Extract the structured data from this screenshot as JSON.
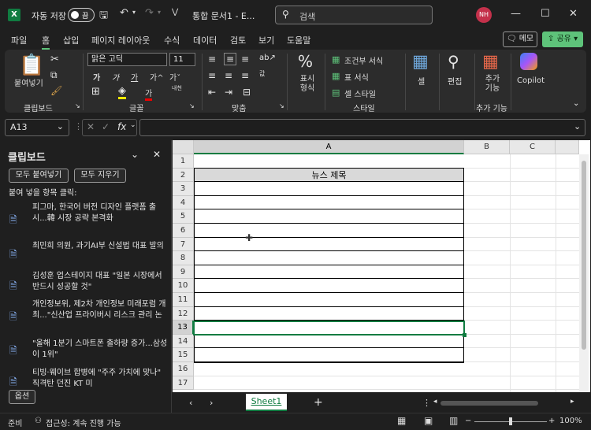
{
  "titlebar": {
    "logo": "X",
    "autosave_label": "자동 저장",
    "toggle_state": "끔",
    "doc_title": "통합 문서1 - E...",
    "search_placeholder": "검색",
    "avatar": "NH",
    "undo_icon": "undo-icon",
    "redo_icon": "redo-icon"
  },
  "menu": [
    "파일",
    "홈",
    "삽입",
    "페이지 레이아웃",
    "수식",
    "데이터",
    "검토",
    "보기",
    "도움말"
  ],
  "memo_label": "메모",
  "share_label": "공유",
  "ribbon": {
    "clipboard": {
      "paste": "붙여넣기",
      "group": "클립보드"
    },
    "font": {
      "name": "맑은 고딕",
      "size": "11",
      "group": "글꼴",
      "bold": "가",
      "italic": "가",
      "underline": "가",
      "grow": "가^",
      "shrink": "가ˇ",
      "fontcolor": "가",
      "phonetic": "내천"
    },
    "align": {
      "group": "맞춤",
      "wrap": "값"
    },
    "number": {
      "label": "표시 형식",
      "pct": "%"
    },
    "styles": {
      "cond": "조건부 서식",
      "table": "표 서식",
      "cell": "셀 스타일",
      "group": "스타일"
    },
    "cells": {
      "label": "셀"
    },
    "editing": {
      "label": "편집"
    },
    "addins": {
      "label": "추가 기능",
      "group": "추가 기능"
    },
    "copilot": {
      "label": "Copilot"
    }
  },
  "formula": {
    "namebox": "A13",
    "value": ""
  },
  "clipboard_pane": {
    "title": "클립보드",
    "paste_all": "모두 붙여넣기",
    "clear_all": "모두 지우기",
    "hint": "붙여 넣을 항목 클릭:",
    "items": [
      "피그마, 한국어 버전 디자인 플랫폼 출시...韓 시장 공략 본격화",
      "최민희 의원, 과기AI부 신설법 대표 발의",
      "김성훈 업스테이지 대표 \"일본 시장에서 반드시 성공할 것\"",
      "개인정보위, 제2차 개인정보 미래포럼 개최...\"신산업 프라이버시 리스크 관리 논",
      "\"올해 1분기 스마트폰 출하량 증가...삼성이 1위\"",
      "티빙·웨이브 합병에 \"주주 가치에 맞나\" 직격탄 던진 KT 미"
    ],
    "options": "옵션"
  },
  "sheet": {
    "columns": [
      "A",
      "B",
      "C"
    ],
    "rows": [
      "1",
      "2",
      "3",
      "4",
      "5",
      "6",
      "7",
      "8",
      "9",
      "10",
      "11",
      "12",
      "13",
      "14",
      "15",
      "16",
      "17"
    ],
    "header_cell": "뉴스 제목",
    "active_col": "A",
    "active_row": "13"
  },
  "sheet_tab": "Sheet1",
  "status": {
    "ready": "준비",
    "accessibility": "접근성: 계속 진행 가능",
    "zoom": "100%"
  }
}
